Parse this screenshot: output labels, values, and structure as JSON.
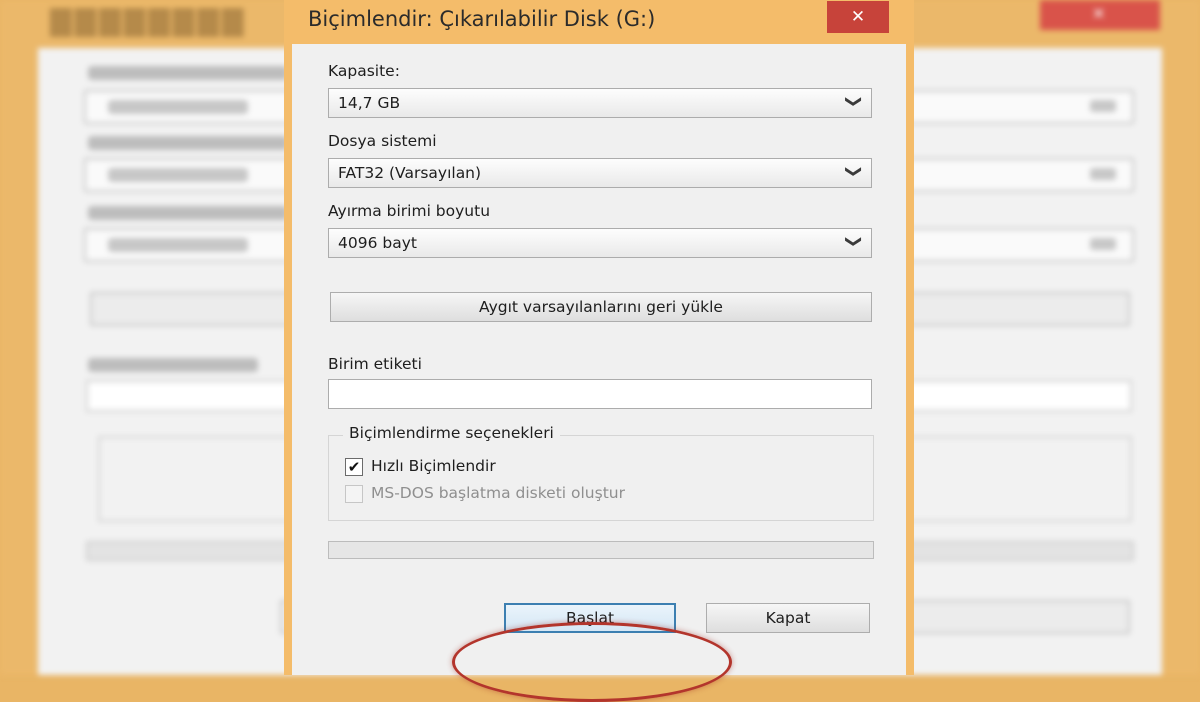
{
  "dialog": {
    "title": "Biçimlendir: Çıkarılabilir Disk (G:)",
    "close_glyph": "✕",
    "capacity": {
      "label": "Kapasite:",
      "value": "14,7 GB"
    },
    "file_system": {
      "label": "Dosya sistemi",
      "value": "FAT32 (Varsayılan)"
    },
    "allocation_unit": {
      "label": "Ayırma birimi boyutu",
      "value": "4096 bayt"
    },
    "restore_defaults_label": "Aygıt varsayılanlarını geri yükle",
    "volume_label": {
      "label": "Birim etiketi",
      "value": ""
    },
    "format_options": {
      "legend": "Biçimlendirme seçenekleri",
      "quick_format": {
        "label": "Hızlı Biçimlendir",
        "checked": true,
        "check_glyph": "✔"
      },
      "msdos_startup": {
        "label": "MS-DOS başlatma disketi oluştur",
        "checked": false,
        "enabled": false
      }
    },
    "progress": 0,
    "start_label": "Başlat",
    "close_label": "Kapat",
    "chevron_glyph": "❯"
  },
  "colors": {
    "window_frame": "#f4bc6a",
    "client_bg": "#f0f0f0",
    "close_button": "#c7433a",
    "highlight_ring": "#b3352c",
    "primary_button_border": "#3c7fb1"
  }
}
